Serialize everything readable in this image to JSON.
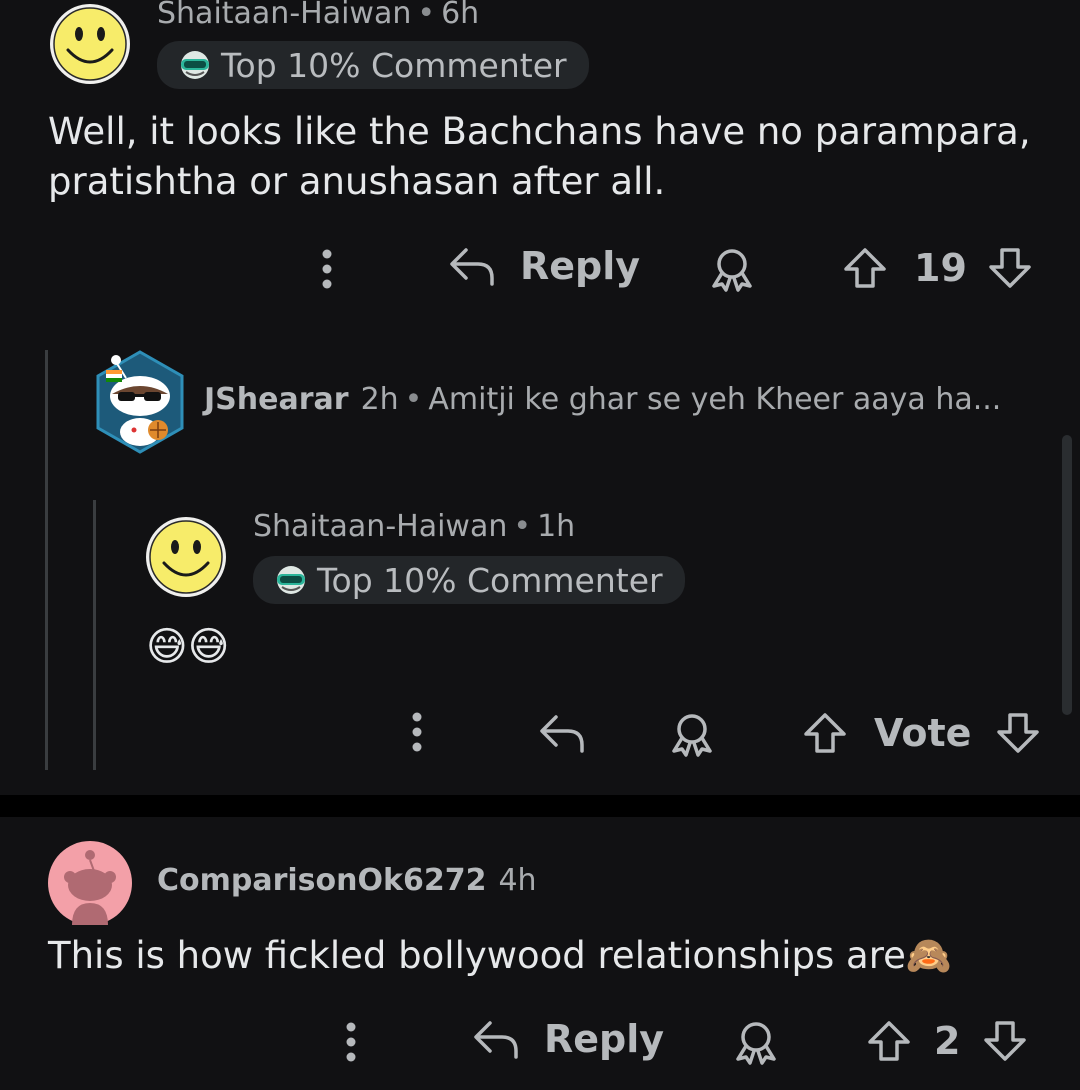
{
  "comments": [
    {
      "username": "Shaitaan-Haiwan",
      "time": "6h",
      "badge": "Top 10% Commenter",
      "body": "Well, it looks like the Bachchans have no parampara, pratishtha or anushasan after all.",
      "reply_label": "Reply",
      "score": "19"
    },
    {
      "username": "JShearar",
      "time": "2h",
      "preview": "Amitji ke ghar se yeh Kheer aaya ha..."
    },
    {
      "username": "Shaitaan-Haiwan",
      "time": "1h",
      "badge": "Top 10% Commenter",
      "body": "😅😅",
      "vote_label": "Vote"
    },
    {
      "username": "ComparisonOk6272",
      "time": "4h",
      "body": "This is how fickled bollywood relationships are🙈",
      "reply_label": "Reply",
      "score": "2"
    }
  ],
  "colors": {
    "background": "#111113",
    "smiley_yellow": "#f7ec6a",
    "badge_bg": "#232629",
    "avatar_pink": "#f3a0a8"
  },
  "icons": [
    "smiley-avatar",
    "snoo-avatar",
    "goggles-icon",
    "more-icon",
    "reply-icon",
    "award-icon",
    "upvote-icon",
    "downvote-icon"
  ]
}
